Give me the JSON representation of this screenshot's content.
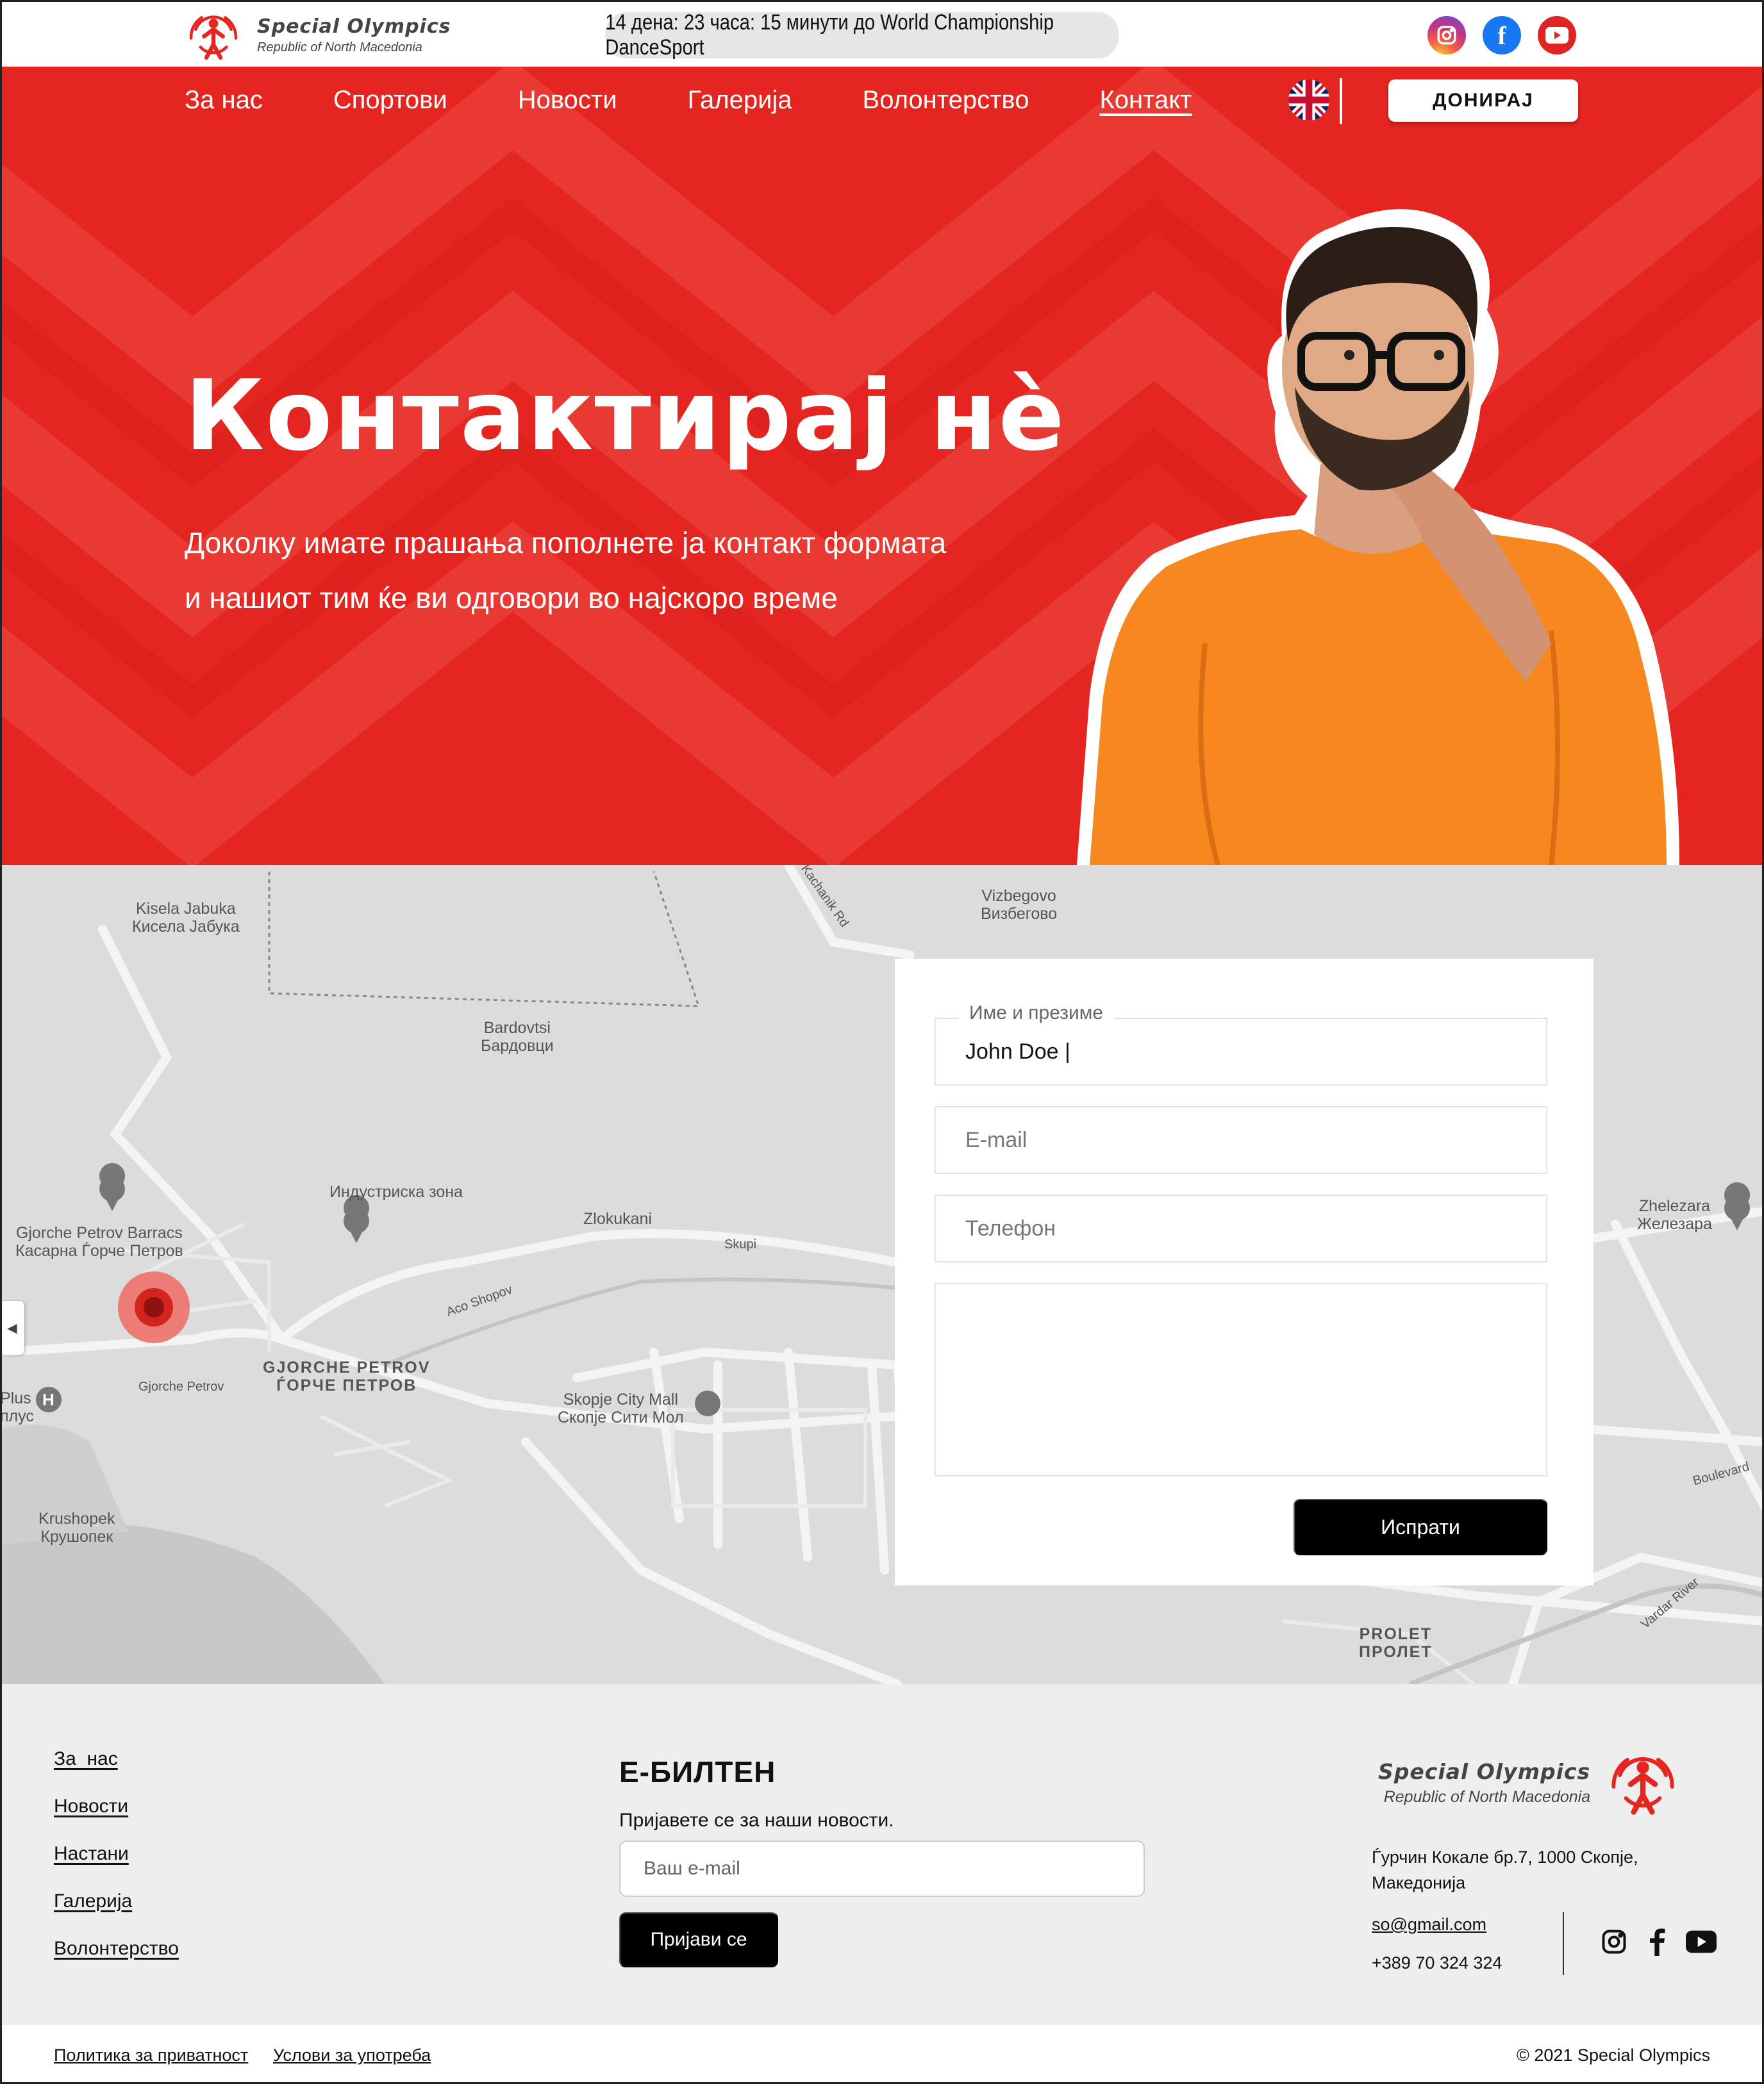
{
  "brand": {
    "name": "Special Olympics",
    "subtitle": "Republic of North Macedonia"
  },
  "topbar": {
    "countdown": "14 дена: 23 часа: 15 минути до World Championship DanceSport",
    "socials": [
      "instagram-icon",
      "facebook-icon",
      "youtube-icon"
    ]
  },
  "nav": {
    "items": [
      "За нас",
      "Спортови",
      "Новости",
      "Галерија",
      "Волонтерство",
      "Контакт"
    ],
    "active": "Контакт",
    "donate_label": "ДОНИРАЈ"
  },
  "hero": {
    "title": "Контактирај нè",
    "subtitle_line1": "Доколку имате прашања пополнете ја контакт формата",
    "subtitle_line2": "и нашиот тим ќе ви одговори во најскоро време"
  },
  "map": {
    "labels": [
      "Kisela Jabuka",
      "Кисела Јабука",
      "Vizbegovo",
      "Визбегово",
      "Bardovtsi",
      "Бардовци",
      "Индустриска зона",
      "Gjorche Petrov Barracs",
      "Касарна Ѓорче Петров",
      "Zlokukani",
      "GJORCHE PETROV",
      "ЃОРЧЕ ПЕТРОВ",
      "Skopje City Mall",
      "Скопје Сити Мол",
      "Krushopek",
      "Крушопек",
      "Zhelezara",
      "Железара",
      "PROLET",
      "ПРОЛЕТ",
      "Plus",
      "плус",
      "Aco Shopov",
      "Skupi",
      "Gjorche Petrov",
      "Kachanik Rd",
      "Boulevard",
      "Vardar River"
    ]
  },
  "form": {
    "name_label": "Име и презиме",
    "name_value": "John Doe |",
    "email_placeholder": "E-mail",
    "phone_placeholder": "Телефон",
    "send_label": "Испрати"
  },
  "footer": {
    "links": [
      "За  нас",
      "Новости",
      "Настани",
      "Галерија",
      "Волонтерство"
    ],
    "newsletter_title": "Е-БИЛТЕН",
    "newsletter_sub": "Пријавете се за наши новости.",
    "newsletter_placeholder": "Ваш e-mail",
    "newsletter_button": "Пријави се",
    "address_line1": "Ѓурчин Кокале бр.7, 1000 Скопје,",
    "address_line2": "Македонија",
    "email": "so@gmail.com",
    "phone": "+389 70 324 324",
    "privacy": "Политика за приватност",
    "terms": "Услови за употреба",
    "copyright": "© 2021 Special Olympics"
  },
  "colors": {
    "brand_red": "#e42520",
    "button_dark": "#000000",
    "map_bg": "#dcdcdc",
    "footer_bg": "#eeeeee"
  }
}
